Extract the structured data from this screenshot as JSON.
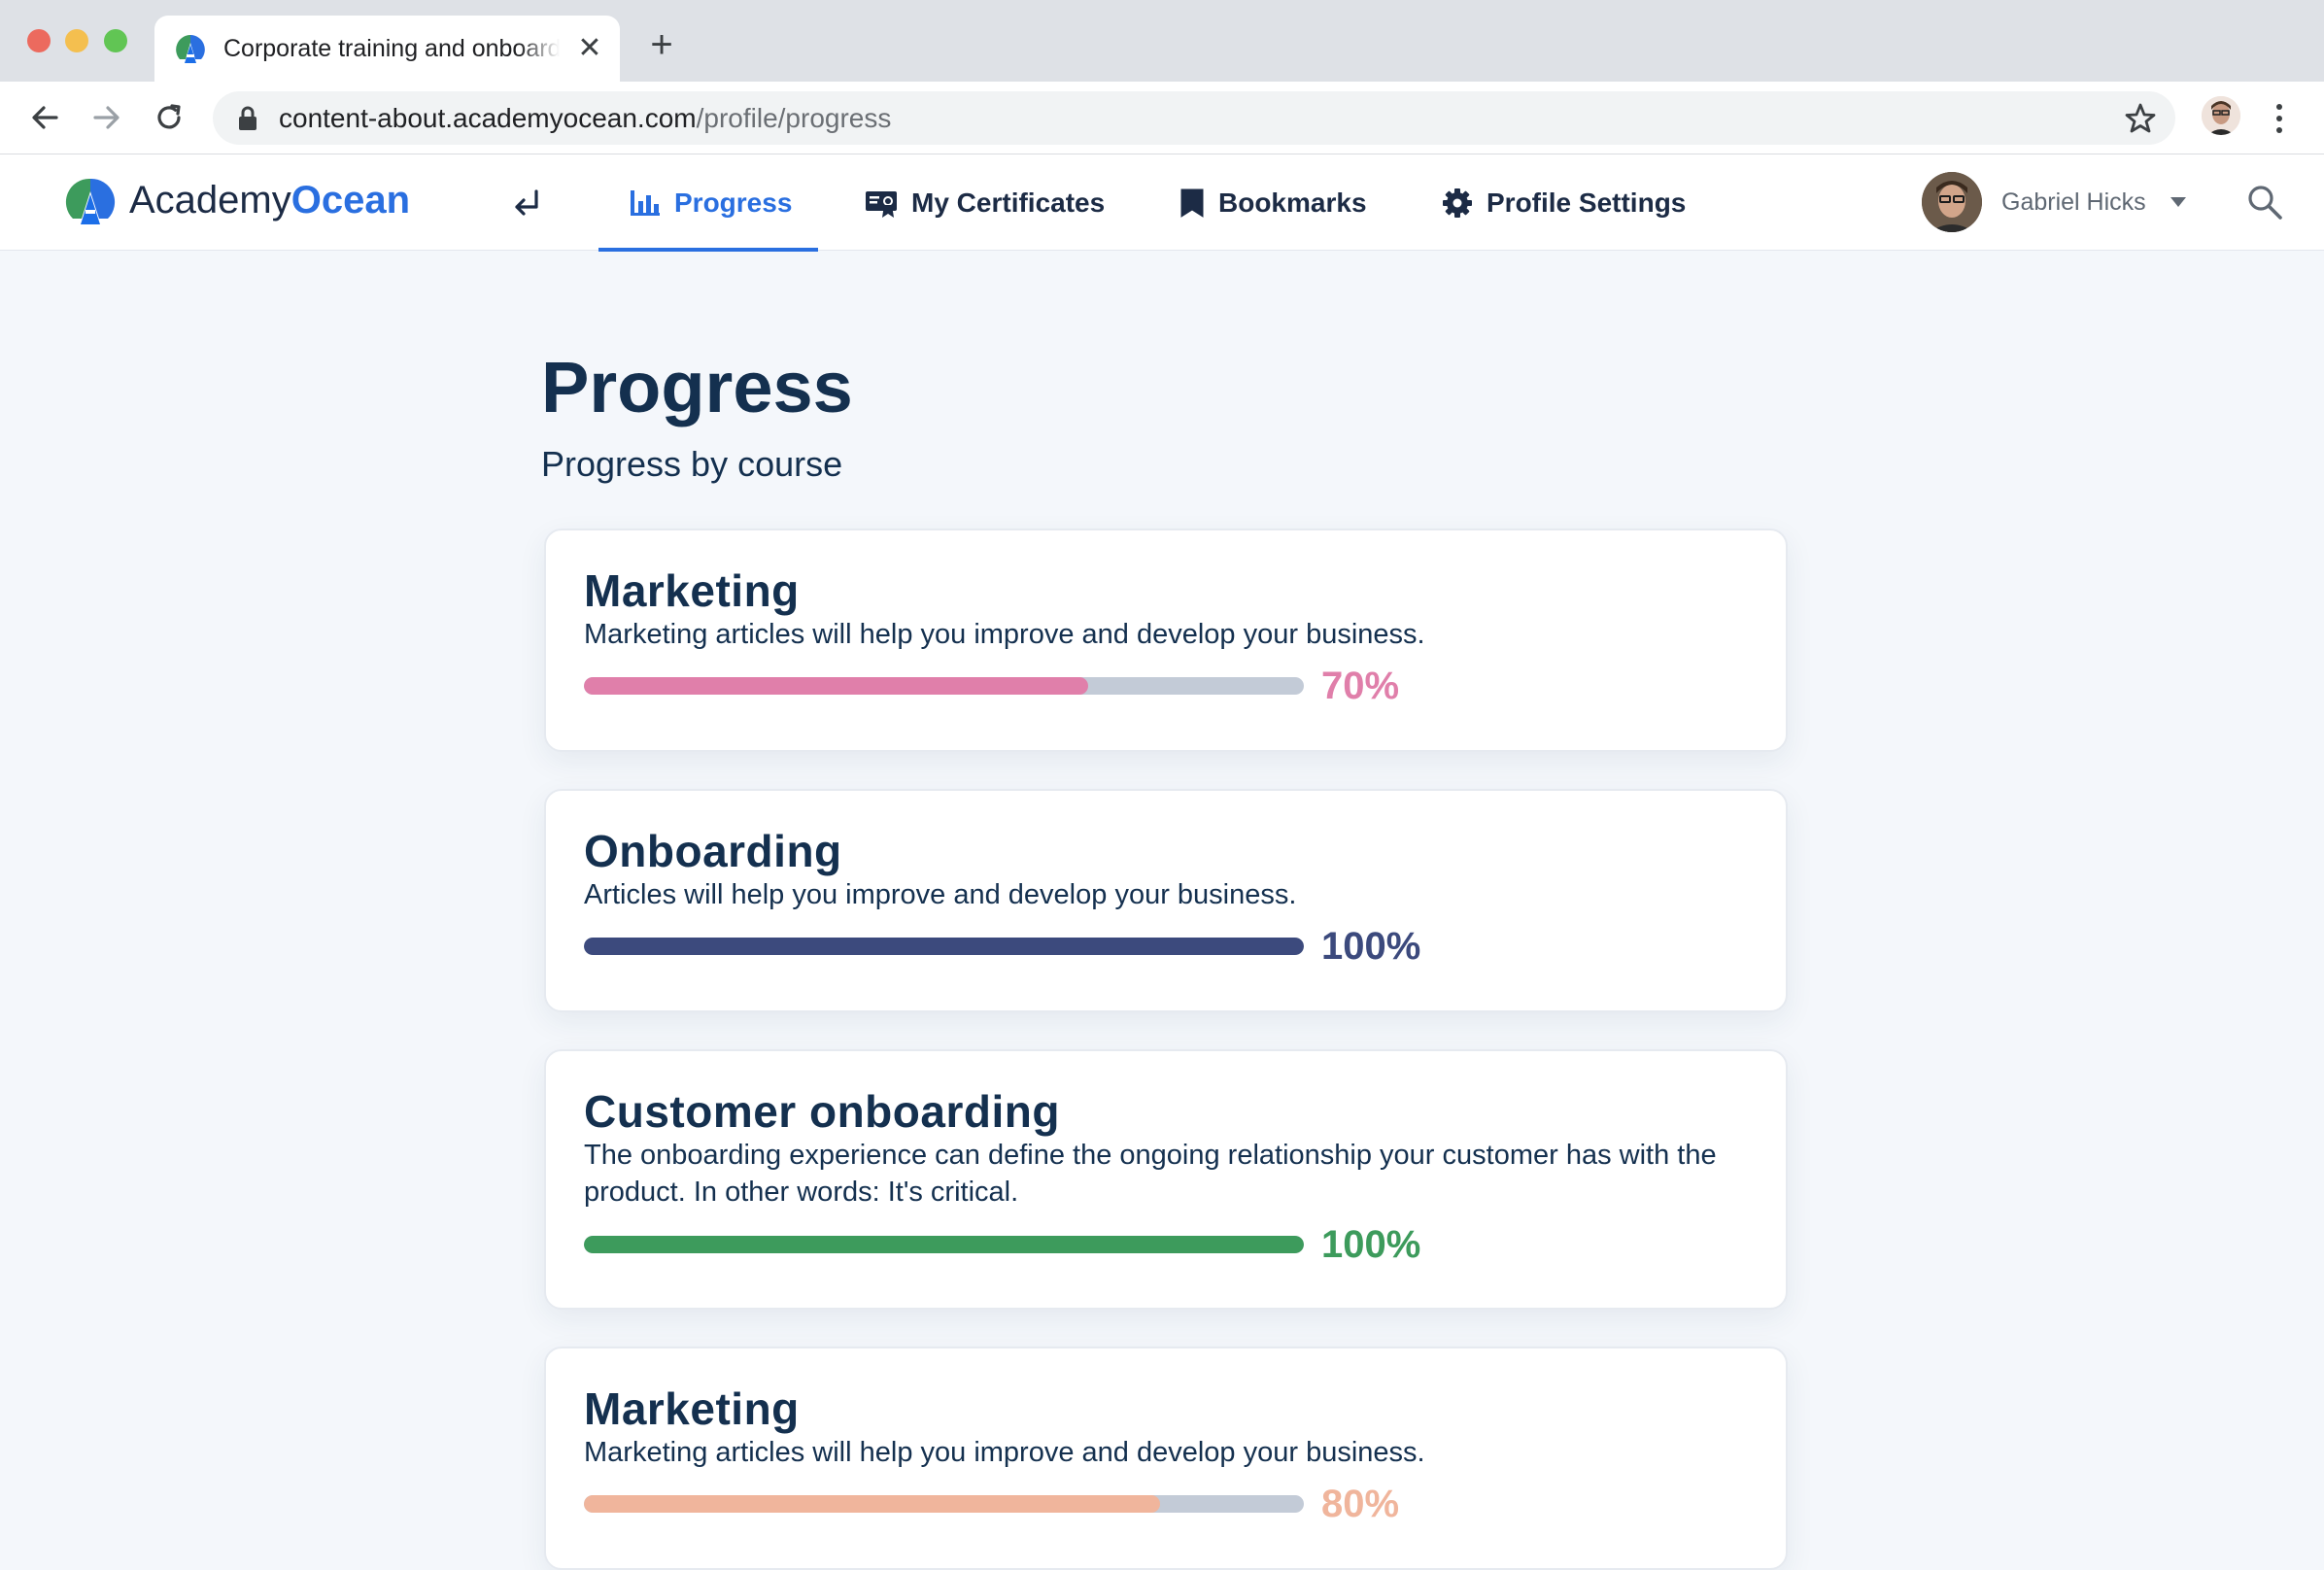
{
  "browser": {
    "tab_title": "Corporate training and onboarding",
    "url_host": "content-about.academyocean.com",
    "url_path": "/profile/progress"
  },
  "header": {
    "logo_academy": "Academy",
    "logo_ocean": "Ocean",
    "nav": [
      {
        "label": "Progress",
        "icon": "bar-chart-icon"
      },
      {
        "label": "My Certificates",
        "icon": "certificate-icon"
      },
      {
        "label": "Bookmarks",
        "icon": "bookmark-icon"
      },
      {
        "label": "Profile Settings",
        "icon": "gear-icon"
      }
    ],
    "user_name": "Gabriel Hicks"
  },
  "page": {
    "title": "Progress",
    "subtitle": "Progress by course"
  },
  "courses": [
    {
      "title": "Marketing",
      "description": "Marketing articles will help you improve and develop your business.",
      "progress_label": "70%",
      "progress": 0.7,
      "color": "#e07faa"
    },
    {
      "title": "Onboarding",
      "description": "Articles will help you improve and develop your business.",
      "progress_label": "100%",
      "progress": 1.0,
      "color": "#3c4a7d"
    },
    {
      "title": "Customer onboarding",
      "description": "The onboarding experience can define the ongoing relationship your customer has with the product. In other words: It's critical.",
      "progress_label": "100%",
      "progress": 1.0,
      "color": "#3d9b5c"
    },
    {
      "title": "Marketing",
      "description": "Marketing articles will help you improve and develop your business.",
      "progress_label": "80%",
      "progress": 0.8,
      "color": "#f0b59c"
    }
  ],
  "colors": {
    "accent": "#2a6fe0",
    "heading": "#14304f",
    "track": "#c3cbd7"
  }
}
